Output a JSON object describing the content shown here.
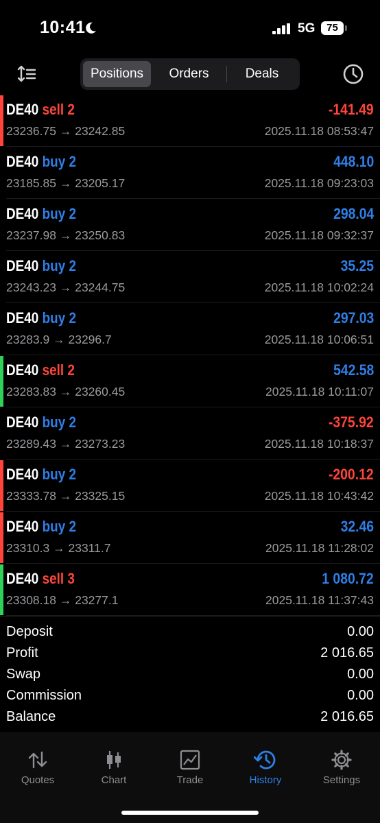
{
  "status": {
    "time": "10:41",
    "network": "5G",
    "battery": "75"
  },
  "tabs": [
    "Positions",
    "Orders",
    "Deals"
  ],
  "colors": {
    "red": "#ff453a",
    "blue": "#2f7fe6",
    "green": "#30d158",
    "gray": "#9a9a9f"
  },
  "positions": [
    {
      "symbol": "DE40",
      "side": "sell 2",
      "side_type": "sell",
      "prices": "23236.75 → 23242.85",
      "profit": "-141.49",
      "profit_type": "loss",
      "time": "2025.11.18 08:53:47",
      "marker": "red"
    },
    {
      "symbol": "DE40",
      "side": "buy 2",
      "side_type": "buy",
      "prices": "23185.85 → 23205.17",
      "profit": "448.10",
      "profit_type": "gain",
      "time": "2025.11.18 09:23:03",
      "marker": "none"
    },
    {
      "symbol": "DE40",
      "side": "buy 2",
      "side_type": "buy",
      "prices": "23237.98 → 23250.83",
      "profit": "298.04",
      "profit_type": "gain",
      "time": "2025.11.18 09:32:37",
      "marker": "none"
    },
    {
      "symbol": "DE40",
      "side": "buy 2",
      "side_type": "buy",
      "prices": "23243.23 → 23244.75",
      "profit": "35.25",
      "profit_type": "gain",
      "time": "2025.11.18 10:02:24",
      "marker": "none"
    },
    {
      "symbol": "DE40",
      "side": "buy 2",
      "side_type": "buy",
      "prices": "23283.9 → 23296.7",
      "profit": "297.03",
      "profit_type": "gain",
      "time": "2025.11.18 10:06:51",
      "marker": "none"
    },
    {
      "symbol": "DE40",
      "side": "sell 2",
      "side_type": "sell",
      "prices": "23283.83 → 23260.45",
      "profit": "542.58",
      "profit_type": "gain",
      "time": "2025.11.18 10:11:07",
      "marker": "green"
    },
    {
      "symbol": "DE40",
      "side": "buy 2",
      "side_type": "buy",
      "prices": "23289.43 → 23273.23",
      "profit": "-375.92",
      "profit_type": "loss",
      "time": "2025.11.18 10:18:37",
      "marker": "none"
    },
    {
      "symbol": "DE40",
      "side": "buy 2",
      "side_type": "buy",
      "prices": "23333.78 → 23325.15",
      "profit": "-200.12",
      "profit_type": "loss",
      "time": "2025.11.18 10:43:42",
      "marker": "red"
    },
    {
      "symbol": "DE40",
      "side": "buy 2",
      "side_type": "buy",
      "prices": "23310.3 → 23311.7",
      "profit": "32.46",
      "profit_type": "gain",
      "time": "2025.11.18 11:28:02",
      "marker": "red"
    },
    {
      "symbol": "DE40",
      "side": "sell 3",
      "side_type": "sell",
      "prices": "23308.18 → 23277.1",
      "profit": "1 080.72",
      "profit_type": "gain",
      "time": "2025.11.18 11:37:43",
      "marker": "green"
    }
  ],
  "summary": [
    {
      "label": "Deposit",
      "value": "0.00"
    },
    {
      "label": "Profit",
      "value": "2 016.65"
    },
    {
      "label": "Swap",
      "value": "0.00"
    },
    {
      "label": "Commission",
      "value": "0.00"
    },
    {
      "label": "Balance",
      "value": "2 016.65"
    }
  ],
  "nav": [
    {
      "label": "Quotes",
      "icon": "quotes-icon"
    },
    {
      "label": "Chart",
      "icon": "candlestick-icon"
    },
    {
      "label": "Trade",
      "icon": "trade-chart-icon"
    },
    {
      "label": "History",
      "icon": "history-icon",
      "active": true
    },
    {
      "label": "Settings",
      "icon": "gear-icon"
    }
  ]
}
